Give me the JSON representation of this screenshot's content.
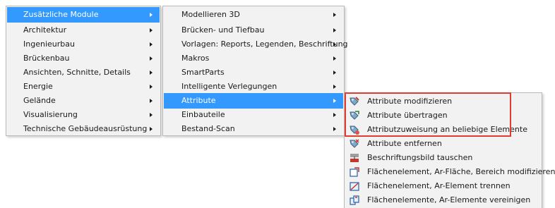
{
  "menu1": {
    "items": [
      {
        "label": "Zusätzliche Module"
      },
      {
        "label": "Architektur"
      },
      {
        "label": "Ingenieurbau"
      },
      {
        "label": "Brückenbau"
      },
      {
        "label": "Ansichten, Schnitte, Details"
      },
      {
        "label": "Energie"
      },
      {
        "label": "Gelände"
      },
      {
        "label": "Visualisierung"
      },
      {
        "label": "Technische Gebäudeausrüstung"
      }
    ],
    "active_index": 0
  },
  "menu2": {
    "items": [
      {
        "label": "Modellieren 3D"
      },
      {
        "label": "Brücken- und Tiefbau"
      },
      {
        "label": "Vorlagen: Reports, Legenden, Beschriftung"
      },
      {
        "label": "Makros"
      },
      {
        "label": "SmartParts"
      },
      {
        "label": "Intelligente Verlegungen"
      },
      {
        "label": "Attribute"
      },
      {
        "label": "Einbauteile"
      },
      {
        "label": "Bestand-Scan"
      }
    ],
    "active_index": 6
  },
  "menu3": {
    "items": [
      {
        "label": "Attribute modifizieren",
        "icon": "attribute-modify-icon"
      },
      {
        "label": "Attribute übertragen",
        "icon": "attribute-transfer-icon"
      },
      {
        "label": "Attributzuweisung an beliebige Elemente",
        "icon": "attribute-assign-icon"
      },
      {
        "label": "Attribute entfernen",
        "icon": "attribute-remove-icon"
      },
      {
        "label": "Beschriftungsbild tauschen",
        "icon": "label-image-swap-icon"
      },
      {
        "label": "Flächenelement, Ar-Fläche, Bereich modifizieren",
        "icon": "area-element-modify-icon"
      },
      {
        "label": "Flächenelement, Ar-Element trennen",
        "icon": "area-element-split-icon"
      },
      {
        "label": "Flächenelemente, Ar-Elemente vereinigen",
        "icon": "area-element-merge-icon"
      }
    ],
    "highlighted_count": 3
  },
  "colors": {
    "active_bg": "#3399ff",
    "highlight_border": "#e03c31",
    "menu_bg": "#f2f2f2"
  }
}
